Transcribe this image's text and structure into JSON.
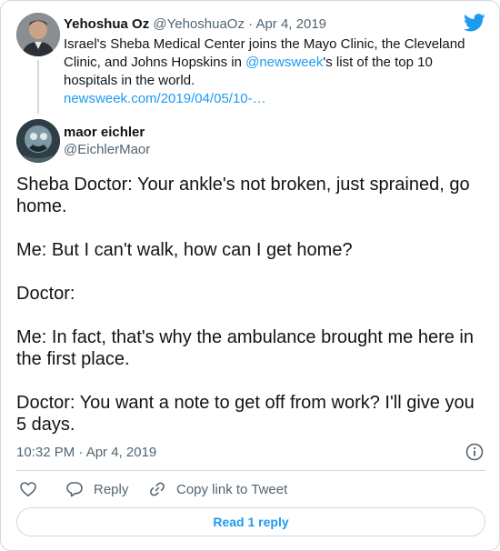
{
  "icons": {
    "brand": "twitter-bird-icon",
    "info": "info-icon",
    "like": "heart-icon",
    "reply": "reply-bubble-icon",
    "copy": "link-icon"
  },
  "colors": {
    "accent": "#1d9bf0",
    "secondary_text": "#536471",
    "border": "#cfd9de"
  },
  "parent_tweet": {
    "author_name": "Yehoshua Oz",
    "meta": "@YehoshuaOz · Apr 4, 2019",
    "text_before_mention": "Israel's Sheba Medical Center joins the Mayo Clinic, the Cleveland Clinic, and Johns Hopskins in ",
    "mention": "@newsweek",
    "text_after_mention": "'s list of the top 10 hospitals in the world.",
    "link": "newsweek.com/2019/04/05/10-…"
  },
  "main_tweet": {
    "author_name": "maor eichler",
    "author_handle": "@EichlerMaor",
    "paragraphs": [
      "Sheba Doctor: Your ankle's not broken, just sprained, go home.",
      "Me: But I can't walk, how can I get home?",
      "Doctor:",
      "Me: In fact, that's why the ambulance brought me here in the first place.",
      "Doctor: You want a note to get off from work? I'll give you 5 days."
    ],
    "timestamp": "10:32 PM · Apr 4, 2019"
  },
  "actions": {
    "reply_label": "Reply",
    "copy_label": "Copy link to Tweet"
  },
  "read_replies_label": "Read 1 reply"
}
